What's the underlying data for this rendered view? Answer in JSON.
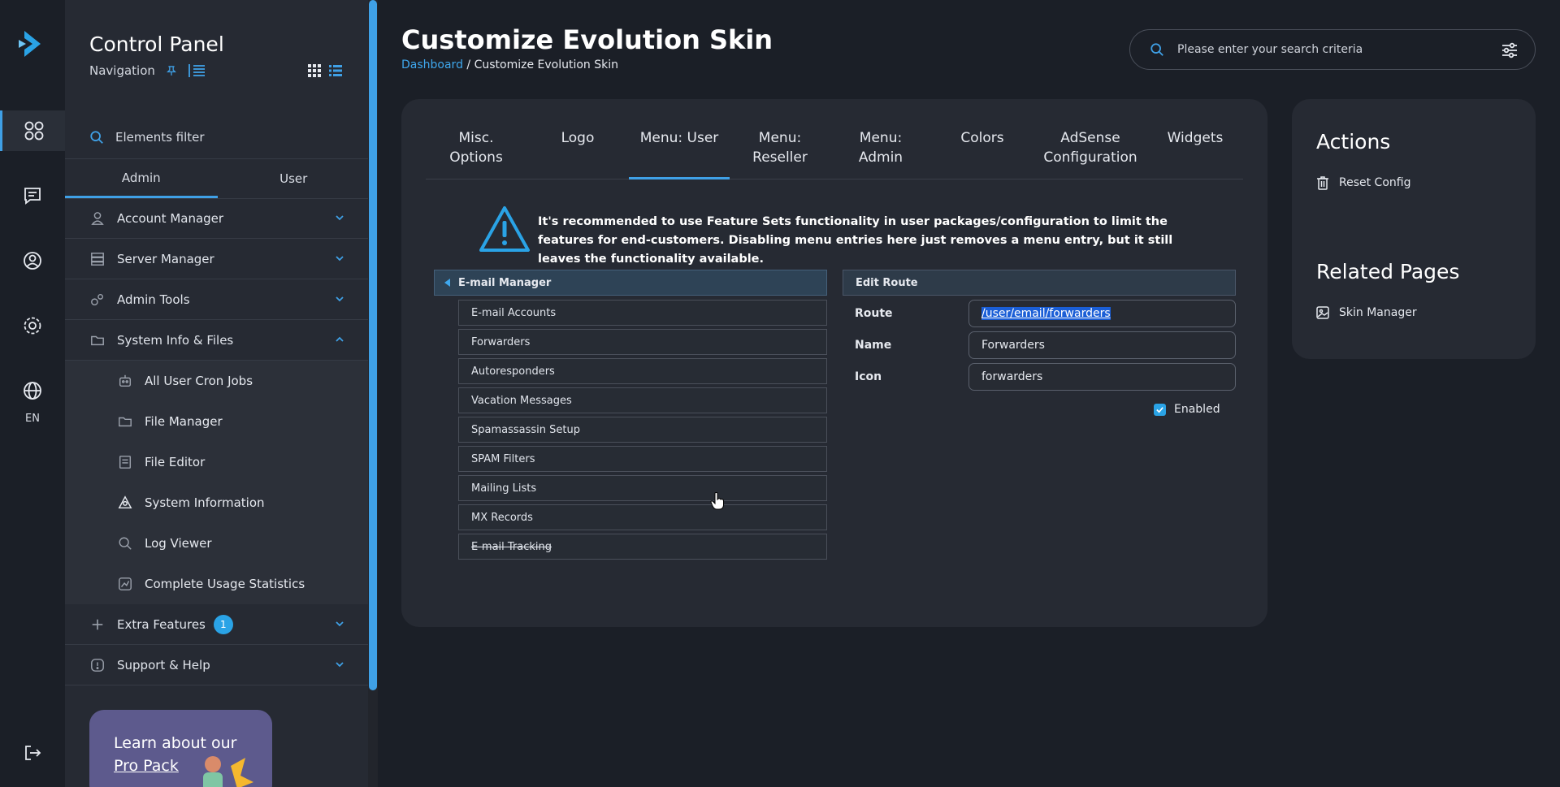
{
  "rail": {
    "lang": "EN",
    "icons": [
      "logo-icon",
      "dashboard-icon",
      "messages-icon",
      "account-icon",
      "settings-icon",
      "language-icon",
      "logout-icon"
    ]
  },
  "sidebar": {
    "title": "Control Panel",
    "nav_label": "Navigation",
    "filter_placeholder": "Elements filter",
    "tabs": [
      "Admin",
      "User"
    ],
    "active_tab": "Admin",
    "menu": [
      {
        "label": "Account Manager",
        "icon": "user-icon"
      },
      {
        "label": "Server Manager",
        "icon": "server-icon"
      },
      {
        "label": "Admin Tools",
        "icon": "tools-icon"
      },
      {
        "label": "System Info & Files",
        "icon": "folder-icon",
        "expanded": true
      }
    ],
    "submenu": [
      {
        "label": "All User Cron Jobs",
        "icon": "robot-icon"
      },
      {
        "label": "File Manager",
        "icon": "folder-icon"
      },
      {
        "label": "File Editor",
        "icon": "document-icon"
      },
      {
        "label": "System Information",
        "icon": "system-icon"
      },
      {
        "label": "Log Viewer",
        "icon": "search-icon"
      },
      {
        "label": "Complete Usage Statistics",
        "icon": "chart-icon"
      }
    ],
    "extra": {
      "label": "Extra Features",
      "badge": "1"
    },
    "support": {
      "label": "Support & Help"
    },
    "promo": {
      "line1": "Learn about our",
      "line2": "Pro Pack"
    }
  },
  "header": {
    "title": "Customize Evolution Skin",
    "breadcrumb_link": "Dashboard",
    "breadcrumb_sep": " / ",
    "breadcrumb_current": "Customize Evolution Skin",
    "search_placeholder": "Please enter your search criteria"
  },
  "tabs": [
    {
      "line1": "Misc.",
      "line2": "Options"
    },
    {
      "line1": "Logo",
      "line2": ""
    },
    {
      "line1": "Menu: User",
      "line2": "",
      "active": true
    },
    {
      "line1": "Menu:",
      "line2": "Reseller"
    },
    {
      "line1": "Menu:",
      "line2": "Admin"
    },
    {
      "line1": "Colors",
      "line2": ""
    },
    {
      "line1": "AdSense",
      "line2": "Configuration"
    },
    {
      "line1": "Widgets",
      "line2": ""
    }
  ],
  "warning": "It's recommended to use Feature Sets functionality in user packages/configuration to limit the features for end-customers. Disabling menu entries here just removes a menu entry, but it still leaves the functionality available.",
  "tree": {
    "group": "E-mail Manager",
    "items": [
      {
        "label": "E-mail Accounts"
      },
      {
        "label": "Forwarders"
      },
      {
        "label": "Autoresponders"
      },
      {
        "label": "Vacation Messages"
      },
      {
        "label": "Spamassassin Setup"
      },
      {
        "label": "SPAM Filters"
      },
      {
        "label": "Mailing Lists"
      },
      {
        "label": "MX Records"
      },
      {
        "label": "E-mail Tracking",
        "disabled": true
      }
    ]
  },
  "edit_route": {
    "title": "Edit Route",
    "route_label": "Route",
    "route_value": "/user/email/forwarders",
    "name_label": "Name",
    "name_value": "Forwarders",
    "icon_label": "Icon",
    "icon_value": "forwarders",
    "enabled_label": "Enabled",
    "enabled": true
  },
  "actions": {
    "title": "Actions",
    "reset": "Reset Config",
    "related_title": "Related Pages",
    "related_link": "Skin Manager"
  },
  "colors": {
    "accent": "#3fa0e6",
    "background": "#1b1f27",
    "card": "#262a33"
  }
}
